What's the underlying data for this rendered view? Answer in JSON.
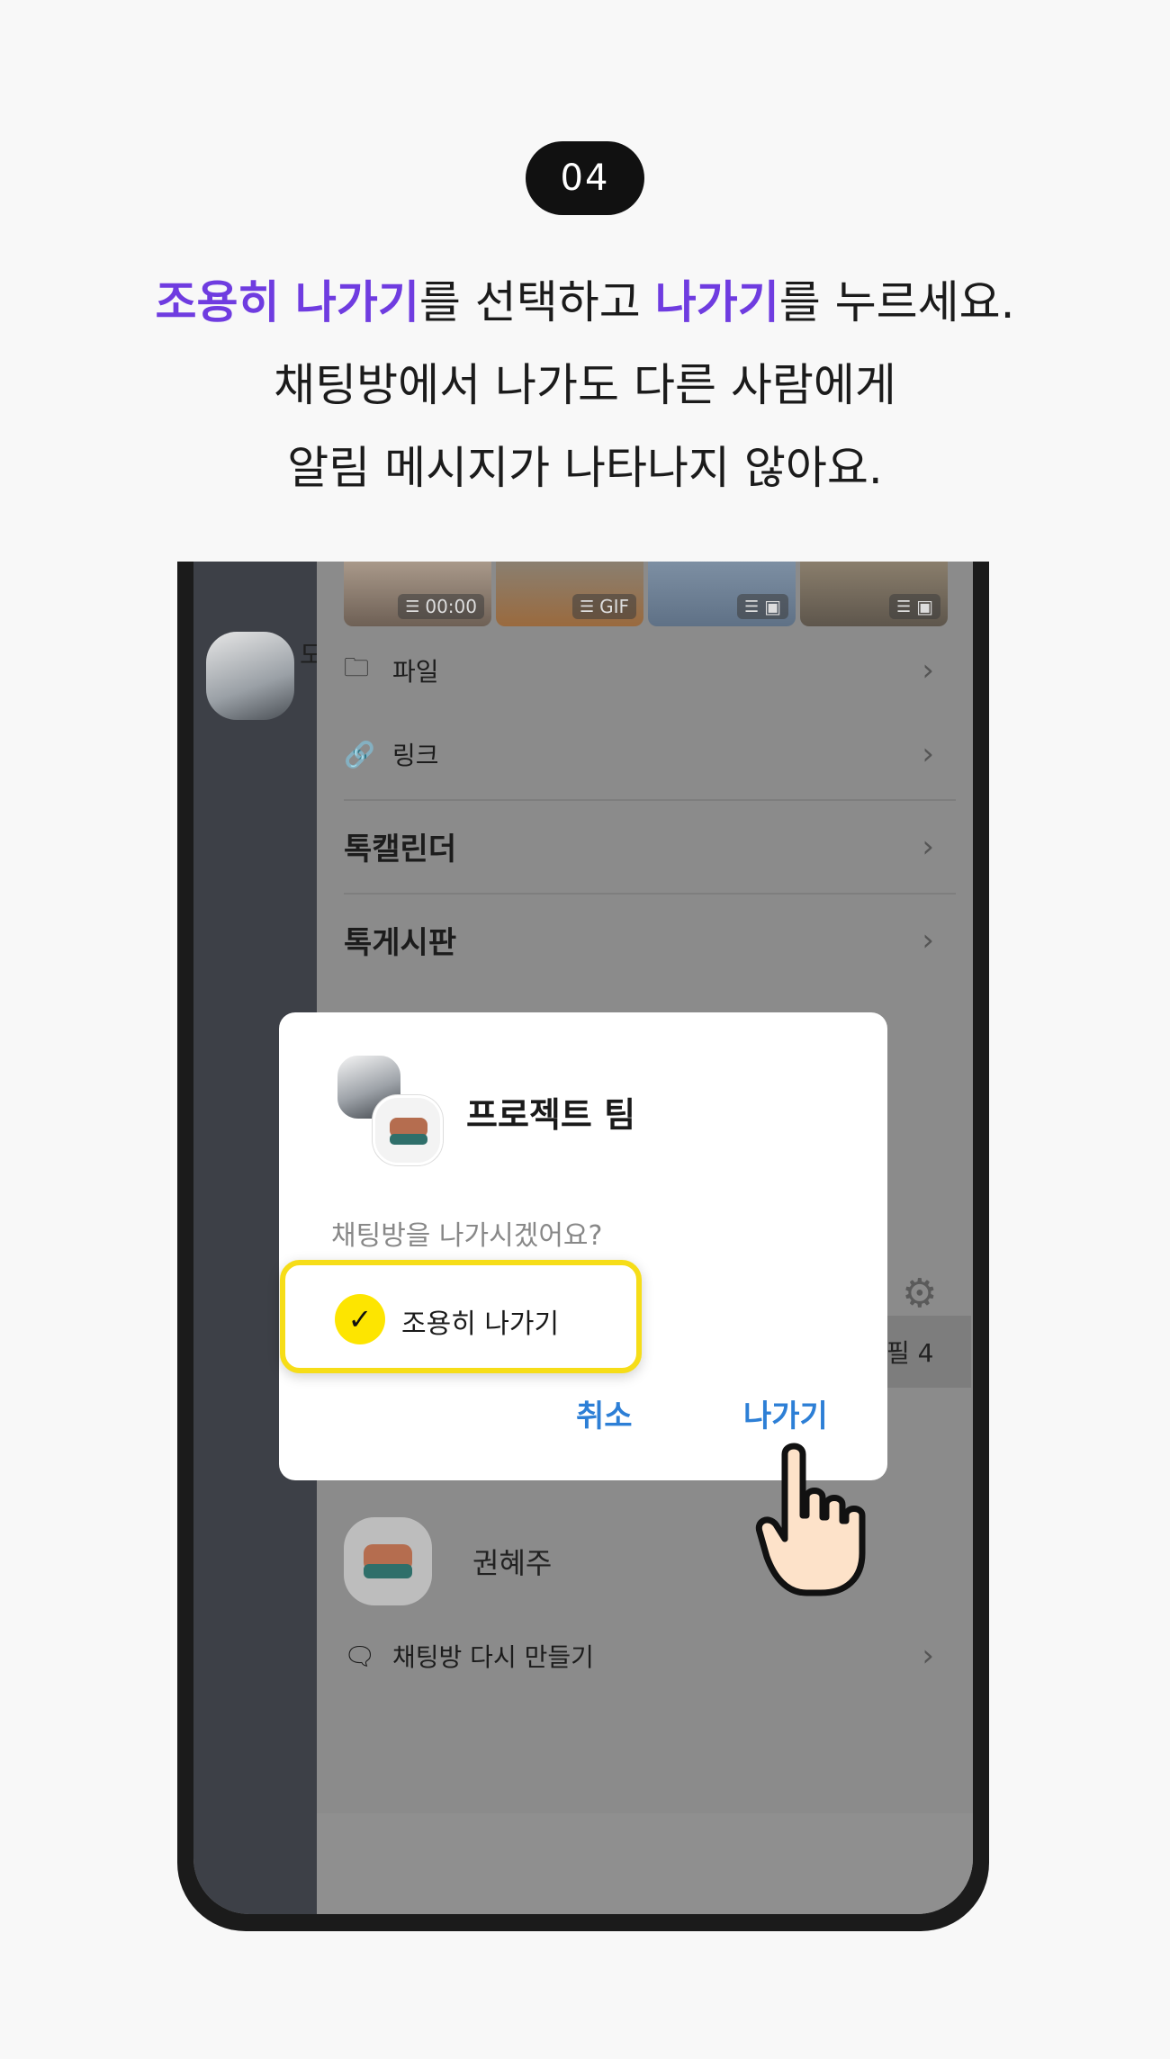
{
  "step": "04",
  "headline": {
    "line1_accent1": "조용히 나가기",
    "line1_text1": "를 선택하고 ",
    "line1_accent2": "나가기",
    "line1_text2": "를 누르세요.",
    "line2": "채팅방에서 나가도 다른 사람에게",
    "line3": "알림 메시지가 나타나지 않아요."
  },
  "colors": {
    "accent": "#6f3ce0",
    "highlight": "#f6dd18",
    "link_blue": "#2d7fd6"
  },
  "phone": {
    "behind_letter": "도",
    "thumbs": [
      {
        "caption": "00:00",
        "icon": "lines-icon"
      },
      {
        "caption": "GIF",
        "icon": "lines-icon"
      },
      {
        "caption": "",
        "icon": "image-icon"
      },
      {
        "caption": "",
        "icon": "image-icon"
      }
    ],
    "menu": {
      "files": "파일",
      "links": "링크",
      "calendar": "톡캘린더",
      "board": "톡게시판"
    },
    "pill_text": "필 4",
    "member_name": "권혜주",
    "remake": "채팅방 다시 만들기"
  },
  "dialog": {
    "room_name": "프로젝트 팀",
    "question": "채팅방을 나가시겠어요?",
    "quiet_option": "조용히 나가기",
    "cancel": "취소",
    "leave": "나가기"
  }
}
